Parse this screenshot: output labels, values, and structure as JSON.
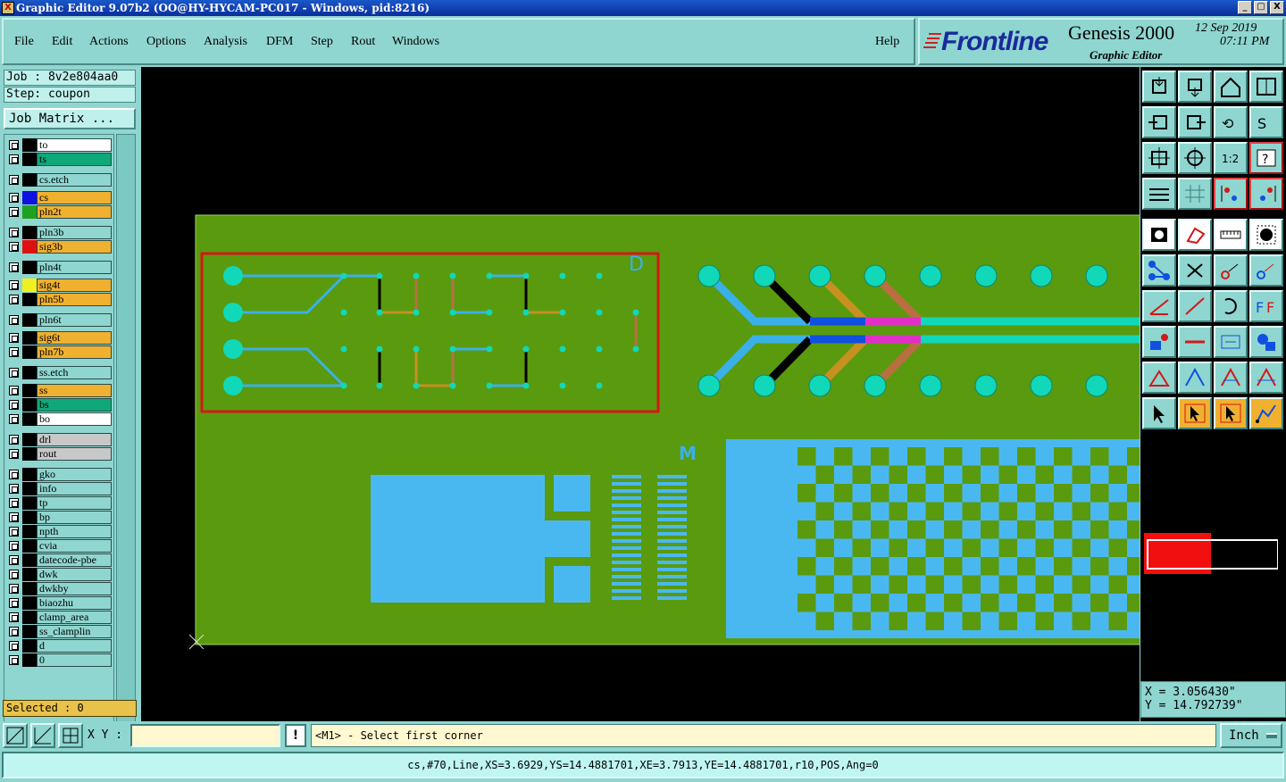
{
  "window": {
    "title": "Graphic Editor 9.07b2 (OO@HY-HYCAM-PC017 - Windows, pid:8216)",
    "buttons": [
      "_",
      "▢",
      "X"
    ]
  },
  "menubar": {
    "items": [
      "File",
      "Edit",
      "Actions",
      "Options",
      "Analysis",
      "DFM",
      "Step",
      "Rout",
      "Windows"
    ],
    "help": "Help"
  },
  "brand": {
    "logo": "Frontline",
    "product": "Genesis 2000",
    "subtitle": "Graphic Editor",
    "date": "12 Sep 2019",
    "time": "07:11 PM"
  },
  "job": {
    "job_line": "Job : 8v2e804aa0",
    "step_line": "Step: coupon",
    "matrix_button": "Job Matrix ..."
  },
  "layers": [
    {
      "name": "to",
      "swatch": "",
      "color": "#ffffff"
    },
    {
      "name": "ts",
      "swatch": "",
      "color": "#0fa878"
    },
    {
      "name": "cs.etch",
      "swatch": "",
      "color": "#8fd6d0"
    },
    {
      "name": "cs",
      "swatch": "#1010e0",
      "color": "#f0b030"
    },
    {
      "name": "pln2t",
      "swatch": "#20a020",
      "color": "#f0b030"
    },
    {
      "name": "pln3b",
      "swatch": "",
      "color": "#8fd6d0"
    },
    {
      "name": "sig3b",
      "swatch": "#e01010",
      "color": "#f0b030"
    },
    {
      "name": "pln4t",
      "swatch": "",
      "color": "#8fd6d0"
    },
    {
      "name": "sig4t",
      "swatch": "#f0f020",
      "color": "#f0b030"
    },
    {
      "name": "pln5b",
      "swatch": "",
      "color": "#f0b030"
    },
    {
      "name": "pln6t",
      "swatch": "",
      "color": "#8fd6d0"
    },
    {
      "name": "sig6t",
      "swatch": "",
      "color": "#f0b030"
    },
    {
      "name": "pln7b",
      "swatch": "",
      "color": "#f0b030"
    },
    {
      "name": "ss.etch",
      "swatch": "",
      "color": "#8fd6d0"
    },
    {
      "name": "ss",
      "swatch": "",
      "color": "#f0b030"
    },
    {
      "name": "bs",
      "swatch": "",
      "color": "#0fa878"
    },
    {
      "name": "bo",
      "swatch": "",
      "color": "#ffffff"
    },
    {
      "name": "drl",
      "swatch": "",
      "color": "#c8c8c8"
    },
    {
      "name": "rout",
      "swatch": "",
      "color": "#c8c8c8"
    },
    {
      "name": "gko",
      "swatch": "",
      "color": "#8fd6d0"
    },
    {
      "name": "info",
      "swatch": "",
      "color": "#8fd6d0"
    },
    {
      "name": "tp",
      "swatch": "",
      "color": "#8fd6d0"
    },
    {
      "name": "bp",
      "swatch": "",
      "color": "#8fd6d0"
    },
    {
      "name": "npth",
      "swatch": "",
      "color": "#8fd6d0"
    },
    {
      "name": "cvia",
      "swatch": "",
      "color": "#8fd6d0"
    },
    {
      "name": "datecode-pbe",
      "swatch": "",
      "color": "#8fd6d0"
    },
    {
      "name": "dwk",
      "swatch": "",
      "color": "#8fd6d0"
    },
    {
      "name": "dwkby",
      "swatch": "",
      "color": "#8fd6d0"
    },
    {
      "name": "biaozhu",
      "swatch": "",
      "color": "#8fd6d0"
    },
    {
      "name": "clamp_area",
      "swatch": "",
      "color": "#8fd6d0"
    },
    {
      "name": "ss_clamplin",
      "swatch": "",
      "color": "#8fd6d0"
    },
    {
      "name": "d",
      "swatch": "",
      "color": "#8fd6d0"
    },
    {
      "name": "0",
      "swatch": "",
      "color": "#8fd6d0"
    }
  ],
  "selected_count": "Selected : 0",
  "canvas": {
    "label_d": "D",
    "label_m": "M"
  },
  "coords": {
    "x": "X = 3.056430\"",
    "y": "Y = 14.792739\""
  },
  "command": {
    "xy_label": "X Y :",
    "xy_value": "",
    "bang": "!",
    "message": "<M1> - Select first corner",
    "units": "Inch"
  },
  "status": "cs,#70,Line,XS=3.6929,YS=14.4881701,XE=3.7913,YE=14.4881701,r10,POS,Ang=0",
  "toolbar_icons": [
    "zoom-home-icon",
    "zoom-out-icon",
    "home-icon",
    "window-icon",
    "pan-left-icon",
    "pan-right-icon",
    "pan-center-icon",
    "redraw-icon",
    "fit-icon",
    "center-icon",
    "scale-icon",
    "query-icon",
    "snap-icon",
    "grid-icon",
    "layer-attr-icon",
    "layer-attr-2-icon",
    "fill-icon",
    "outline-icon",
    "measure-icon",
    "pad-icon",
    "connect-icon",
    "delete-icon",
    "move-icon",
    "copy-icon",
    "line-icon",
    "line2-icon",
    "arc-icon",
    "text-icon",
    "snap-pad-icon",
    "minus-icon",
    "resize-icon",
    "net-icon",
    "triangle-icon",
    "triangle2-icon",
    "triangle3-icon",
    "triangle4-icon",
    "select-icon",
    "select2-icon",
    "select3-icon",
    "route-icon"
  ]
}
